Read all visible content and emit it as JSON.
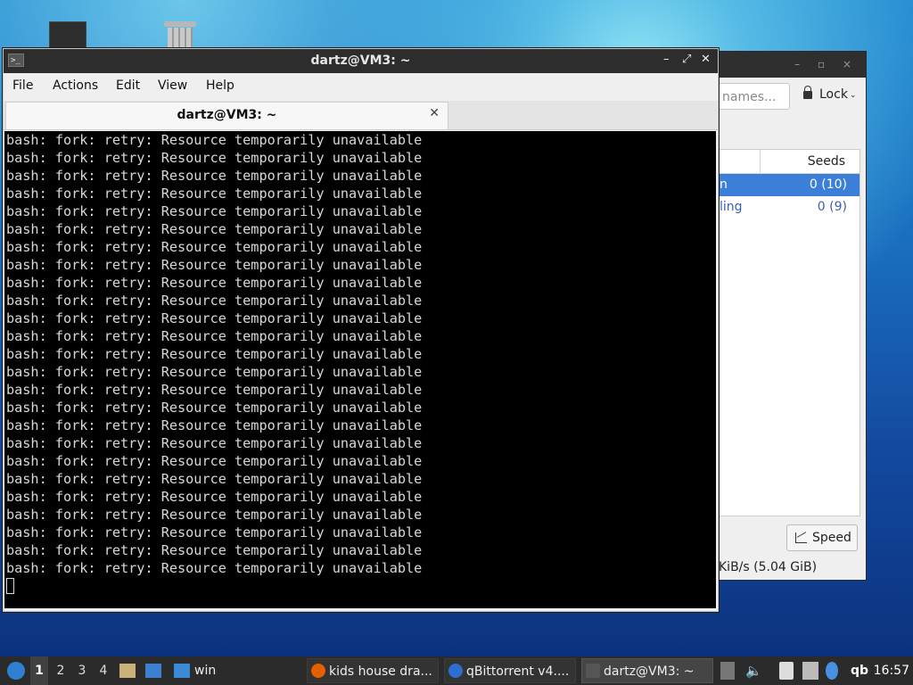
{
  "terminal": {
    "window_title": "dartz@VM3: ~",
    "tab_label": "dartz@VM3: ~",
    "menu": [
      "File",
      "Actions",
      "Edit",
      "View",
      "Help"
    ],
    "output_line": "bash: fork: retry: Resource temporarily unavailable",
    "output_line_count": 25
  },
  "qbittorrent": {
    "search_placeholder": "names...",
    "lock_label": "Lock",
    "column_seeds": "Seeds",
    "rows": [
      {
        "name": "n",
        "seeds": "0 (10)"
      },
      {
        "name": "ling",
        "seeds": "0 (9)"
      }
    ],
    "speed_button": "Speed",
    "status_text": "KiB/s (5.04 GiB)"
  },
  "taskbar": {
    "workspaces": [
      "1",
      "2",
      "3",
      "4"
    ],
    "active_workspace": "1",
    "launcher_folder_label": "win",
    "tasks": [
      {
        "label": "kids house dra..."
      },
      {
        "label": "qBittorrent v4...."
      },
      {
        "label": "dartz@VM3: ~"
      }
    ],
    "tray_qb": "qb",
    "clock": "16:57"
  }
}
